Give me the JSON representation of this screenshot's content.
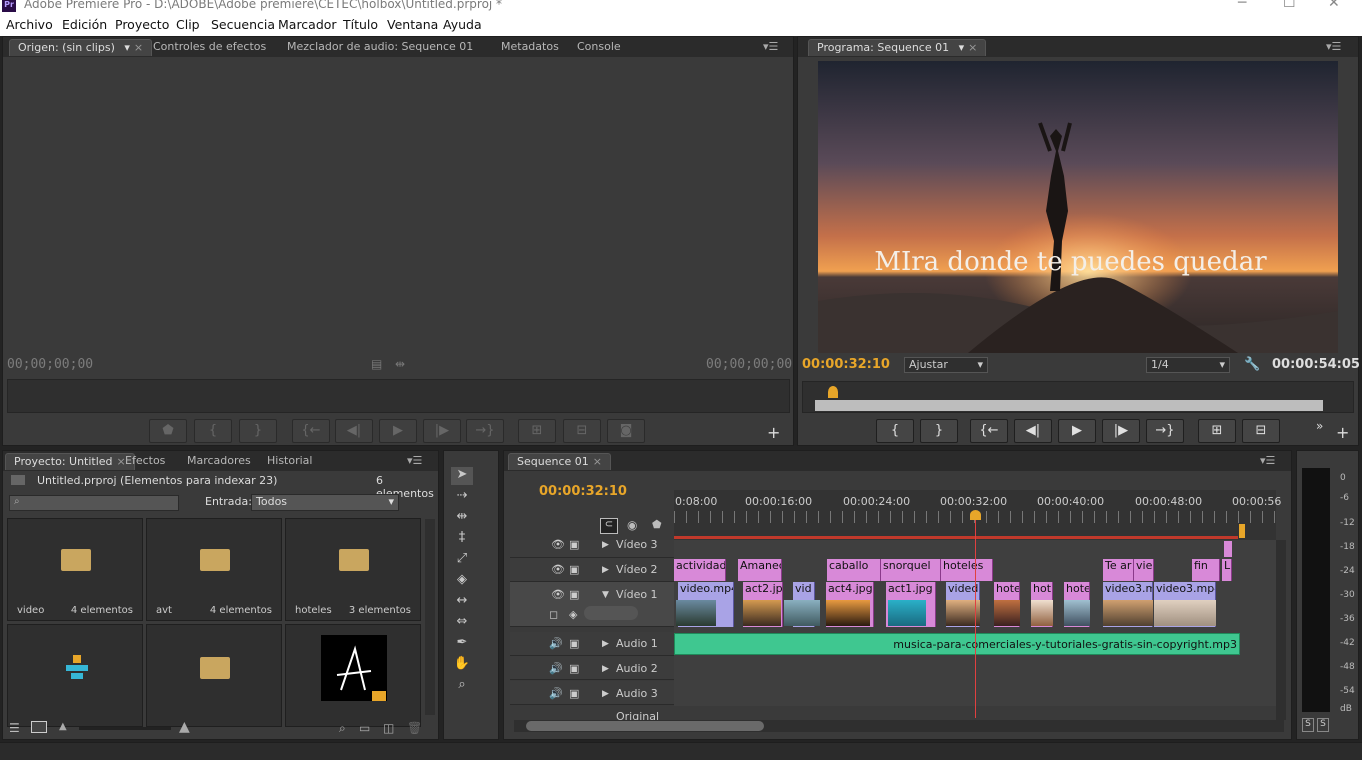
{
  "app": {
    "title": "Adobe Premiere Pro - D:\\ADOBE\\Adobe premiere\\CETEC\\holbox\\Untitled.prproj *",
    "icon": "Pr"
  },
  "menu": [
    "Archivo",
    "Edición",
    "Proyecto",
    "Clip",
    "Secuencia",
    "Marcador",
    "Título",
    "Ventana",
    "Ayuda"
  ],
  "source": {
    "tabs": [
      "Origen: (sin clips)",
      "Controles de efectos",
      "Mezclador de audio: Sequence 01",
      "Metadatos",
      "Console"
    ],
    "tc_in": "00;00;00;00",
    "tc_out": "00;00;00;00"
  },
  "program": {
    "tab": "Programa: Sequence 01",
    "overlay_text": "MIra donde te puedes quedar",
    "tc_current": "00:00:32:10",
    "fit": "Ajustar",
    "resolution": "1/4",
    "tc_duration": "00:00:54:05"
  },
  "project": {
    "tabs": [
      "Proyecto: Untitled",
      "Efectos",
      "Marcadores",
      "Historial"
    ],
    "file": "Untitled.prproj (Elementos para indexar 23)",
    "count": "6 elementos",
    "entrada_label": "Entrada:",
    "entrada_value": "Todos",
    "bins": [
      {
        "name": "video",
        "count": "4 elementos"
      },
      {
        "name": "avt",
        "count": "4 elementos"
      },
      {
        "name": "hoteles",
        "count": "3 elementos"
      }
    ]
  },
  "timeline": {
    "tab": "Sequence 01",
    "tc": "00:00:32:10",
    "ruler": [
      "0:08:00",
      "00:00:16:00",
      "00:00:24:00",
      "00:00:32:00",
      "00:00:40:00",
      "00:00:48:00",
      "00:00:56"
    ],
    "tracks": {
      "v3": "Vídeo 3",
      "v2": "Vídeo 2",
      "v1": "Vídeo 1",
      "a1": "Audio 1",
      "a2": "Audio 2",
      "a3": "Audio 3",
      "orig": "Original"
    },
    "v2_clips": [
      "actividade",
      "Amanec",
      "caballo",
      "snorquel",
      "hoteles",
      "Te ar",
      "viei",
      "fin",
      "L"
    ],
    "v1_clips": [
      "video.mp4",
      "act2.jpg",
      "vid",
      "act4.jpg",
      "act1.jpg",
      "vided",
      "hote",
      "hot",
      "hote",
      "video3.mp",
      "video3.mp4"
    ],
    "audio_clip": "musica-para-comerciales-y-tutoriales-gratis-sin-copyright.mp3"
  },
  "meter": {
    "labels": [
      "0",
      "-6",
      "-12",
      "-18",
      "-24",
      "-30",
      "-36",
      "-42",
      "-48",
      "-54",
      "dB"
    ],
    "solo": [
      "S",
      "S"
    ]
  }
}
